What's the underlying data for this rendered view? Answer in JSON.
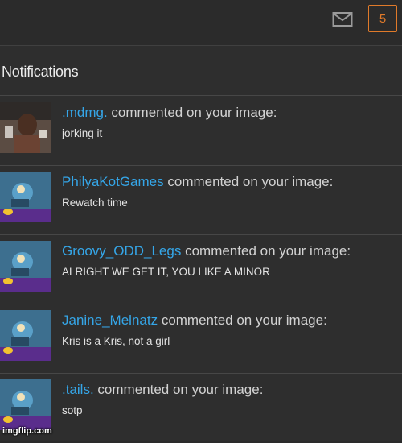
{
  "header": {
    "mail_icon": "envelope-icon",
    "notification_count": "5",
    "accent_color": "#e07a2a"
  },
  "panel": {
    "title": "Notifications",
    "link_color": "#35a6e8"
  },
  "notifications": [
    {
      "user": ".mdmg.",
      "action": "commented on your image:",
      "comment": "jorking it"
    },
    {
      "user": "PhilyaKotGames",
      "action": "commented on your image:",
      "comment": "Rewatch time"
    },
    {
      "user": "Groovy_ODD_Legs",
      "action": "commented on your image:",
      "comment": "ALRIGHT WE GET IT, YOU LIKE A MINOR"
    },
    {
      "user": "Janine_Melnatz",
      "action": "commented on your image:",
      "comment": "Kris is a Kris, not a girl"
    },
    {
      "user": ".tails.",
      "action": "commented on your image:",
      "comment": "sotp"
    }
  ],
  "watermark": "imgflip.com"
}
